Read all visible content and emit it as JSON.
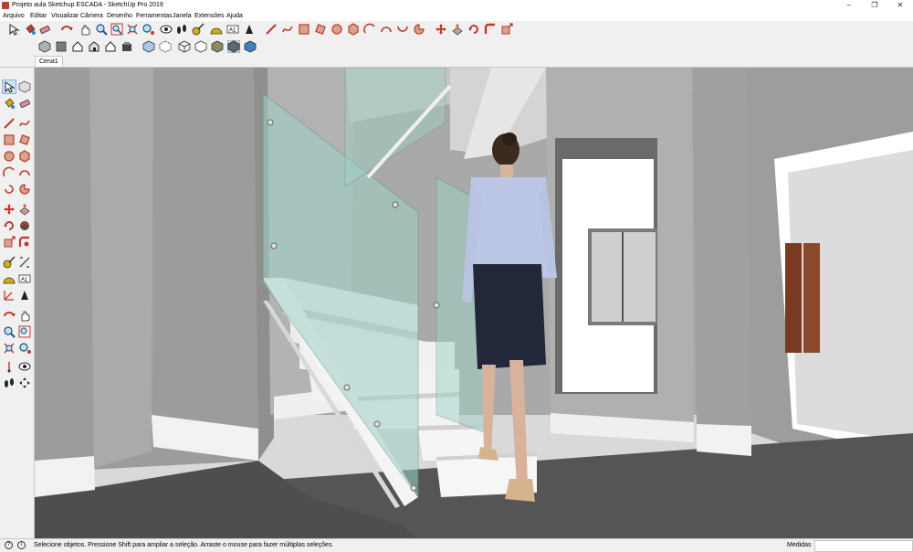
{
  "window": {
    "title": "Projeto aula Sketchup ESCADA - SketchUp Pro 2019",
    "controls": [
      "minimize-icon",
      "maximize-icon",
      "close-icon"
    ]
  },
  "menu": {
    "items": [
      "Arquivo",
      "Editar",
      "Visualizar",
      "Câmera",
      "Desenho",
      "Ferramentas",
      "Janela",
      "Extensões",
      "Ajuda"
    ]
  },
  "toolbar_top": {
    "icons": [
      "select-icon",
      "paint-bucket-icon",
      "eraser-icon",
      "orbit-icon",
      "pan-icon",
      "zoom-icon",
      "zoom-window-icon",
      "zoom-extents-icon",
      "position-camera-icon",
      "look-around-icon",
      "walk-icon",
      "tape-measure-icon",
      "protractor-icon",
      "text-icon",
      "axes-icon",
      "line-icon",
      "freehand-icon",
      "rectangle-icon",
      "rotated-rectangle-icon",
      "circle-icon",
      "polygon-icon",
      "arc-icon",
      "two-point-arc-icon",
      "three-point-arc-icon",
      "pie-icon",
      "move-icon",
      "push-pull-icon",
      "rotate-icon",
      "follow-me-icon",
      "scale-icon"
    ]
  },
  "toolbar_views": {
    "icons": [
      "iso-view-icon",
      "top-view-icon",
      "front-view-icon",
      "right-view-icon",
      "back-view-icon",
      "left-view-icon",
      "xray-icon",
      "back-edges-icon",
      "wireframe-icon",
      "hidden-line-icon",
      "shaded-icon",
      "shaded-textures-icon",
      "monochrome-icon"
    ]
  },
  "tabs": {
    "scene_label": "Cena1"
  },
  "left_toolbar": {
    "icons": [
      "select-icon",
      "make-component-icon",
      "paint-bucket-icon",
      "eraser-icon",
      "line-icon",
      "freehand-icon",
      "rectangle-icon",
      "rotated-rectangle-icon",
      "circle-icon",
      "polygon-icon",
      "arc-icon",
      "pie-icon",
      "move-icon",
      "push-pull-icon",
      "rotate-icon",
      "follow-me-icon",
      "scale-icon",
      "offset-icon",
      "tape-measure-icon",
      "dimension-icon",
      "protractor-icon",
      "text-icon",
      "axes-icon",
      "3d-text-icon",
      "orbit-icon",
      "pan-icon",
      "zoom-icon",
      "zoom-window-icon",
      "zoom-extents-icon",
      "position-camera-icon",
      "walk-icon",
      "look-around-icon",
      "section-plane-icon"
    ]
  },
  "status": {
    "hint": "Selecione objetos. Pressione Shift para ampliar a seleção. Arraste o mouse para fazer múltiplas seleções.",
    "measures_label": "Medidas",
    "measures_value": ""
  },
  "colors": {
    "accent_red": "#c0392b",
    "glass": "#9fd1c6",
    "wall": "#a7a7a7",
    "floor": "#545454",
    "stairs": "#f3f3f3"
  }
}
